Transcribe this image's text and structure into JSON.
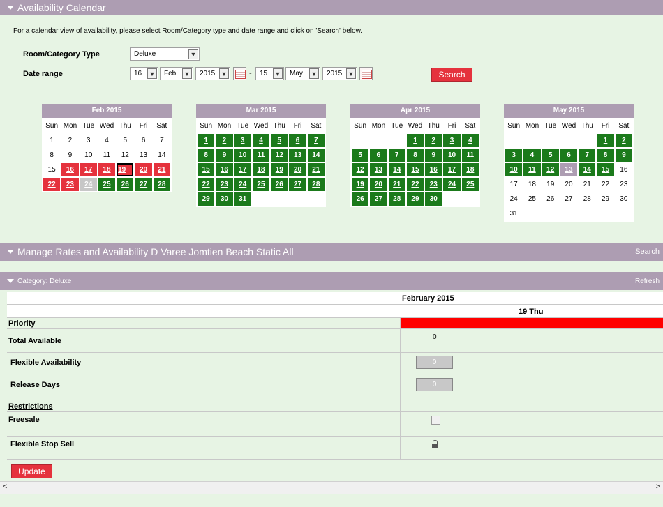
{
  "availability": {
    "title": "Availability Calendar",
    "intro": "For a calendar view of availability, please select Room/Category type and date range and click on 'Search' below.",
    "room_label": "Room/Category Type",
    "room_value": "Deluxe",
    "date_label": "Date range",
    "from_day": "16",
    "from_month": "Feb",
    "from_year": "2015",
    "separator": "-",
    "to_day": "15",
    "to_month": "May",
    "to_year": "2015",
    "search_label": "Search"
  },
  "weekdays": [
    "Sun",
    "Mon",
    "Tue",
    "Wed",
    "Thu",
    "Fri",
    "Sat"
  ],
  "calendars": [
    {
      "title": "Feb 2015",
      "weeks": [
        [
          [
            "1",
            ""
          ],
          [
            "2",
            ""
          ],
          [
            "3",
            ""
          ],
          [
            "4",
            ""
          ],
          [
            "5",
            ""
          ],
          [
            "6",
            ""
          ],
          [
            "7",
            ""
          ]
        ],
        [
          [
            "8",
            ""
          ],
          [
            "9",
            ""
          ],
          [
            "10",
            ""
          ],
          [
            "11",
            ""
          ],
          [
            "12",
            ""
          ],
          [
            "13",
            ""
          ],
          [
            "14",
            ""
          ]
        ],
        [
          [
            "15",
            ""
          ],
          [
            "16",
            "r"
          ],
          [
            "17",
            "r"
          ],
          [
            "18",
            "r"
          ],
          [
            "19",
            "r sel"
          ],
          [
            "20",
            "r"
          ],
          [
            "21",
            "r"
          ]
        ],
        [
          [
            "22",
            "r"
          ],
          [
            "23",
            "r"
          ],
          [
            "24",
            "g"
          ],
          [
            "25",
            "a"
          ],
          [
            "26",
            "a"
          ],
          [
            "27",
            "a"
          ],
          [
            "28",
            "a"
          ]
        ]
      ]
    },
    {
      "title": "Mar 2015",
      "weeks": [
        [
          [
            "1",
            "a"
          ],
          [
            "2",
            "a"
          ],
          [
            "3",
            "a"
          ],
          [
            "4",
            "a"
          ],
          [
            "5",
            "a"
          ],
          [
            "6",
            "a"
          ],
          [
            "7",
            "a"
          ]
        ],
        [
          [
            "8",
            "a"
          ],
          [
            "9",
            "a"
          ],
          [
            "10",
            "a"
          ],
          [
            "11",
            "a"
          ],
          [
            "12",
            "a"
          ],
          [
            "13",
            "a"
          ],
          [
            "14",
            "a"
          ]
        ],
        [
          [
            "15",
            "a"
          ],
          [
            "16",
            "a"
          ],
          [
            "17",
            "a"
          ],
          [
            "18",
            "a"
          ],
          [
            "19",
            "a"
          ],
          [
            "20",
            "a"
          ],
          [
            "21",
            "a"
          ]
        ],
        [
          [
            "22",
            "a"
          ],
          [
            "23",
            "a"
          ],
          [
            "24",
            "a"
          ],
          [
            "25",
            "a"
          ],
          [
            "26",
            "a"
          ],
          [
            "27",
            "a"
          ],
          [
            "28",
            "a"
          ]
        ],
        [
          [
            "29",
            "a"
          ],
          [
            "30",
            "a"
          ],
          [
            "31",
            "a"
          ],
          [
            "",
            ""
          ],
          [
            "",
            ""
          ],
          [
            "",
            ""
          ],
          [
            "",
            ""
          ]
        ]
      ]
    },
    {
      "title": "Apr 2015",
      "weeks": [
        [
          [
            "",
            ""
          ],
          [
            "",
            ""
          ],
          [
            "",
            ""
          ],
          [
            "1",
            "a"
          ],
          [
            "2",
            "a"
          ],
          [
            "3",
            "a"
          ],
          [
            "4",
            "a"
          ]
        ],
        [
          [
            "5",
            "a"
          ],
          [
            "6",
            "a"
          ],
          [
            "7",
            "a"
          ],
          [
            "8",
            "a"
          ],
          [
            "9",
            "a"
          ],
          [
            "10",
            "a"
          ],
          [
            "11",
            "a"
          ]
        ],
        [
          [
            "12",
            "a"
          ],
          [
            "13",
            "a"
          ],
          [
            "14",
            "a"
          ],
          [
            "15",
            "a"
          ],
          [
            "16",
            "a"
          ],
          [
            "17",
            "a"
          ],
          [
            "18",
            "a"
          ]
        ],
        [
          [
            "19",
            "a"
          ],
          [
            "20",
            "a"
          ],
          [
            "21",
            "a"
          ],
          [
            "22",
            "a"
          ],
          [
            "23",
            "a"
          ],
          [
            "24",
            "a"
          ],
          [
            "25",
            "a"
          ]
        ],
        [
          [
            "26",
            "a"
          ],
          [
            "27",
            "a"
          ],
          [
            "28",
            "a"
          ],
          [
            "29",
            "a"
          ],
          [
            "30",
            "a"
          ],
          [
            "",
            ""
          ],
          [
            "",
            ""
          ]
        ]
      ]
    },
    {
      "title": "May 2015",
      "weeks": [
        [
          [
            "",
            ""
          ],
          [
            "",
            ""
          ],
          [
            "",
            ""
          ],
          [
            "",
            ""
          ],
          [
            "",
            ""
          ],
          [
            "1",
            "a"
          ],
          [
            "2",
            "a"
          ]
        ],
        [
          [
            "3",
            "a"
          ],
          [
            "4",
            "a"
          ],
          [
            "5",
            "a"
          ],
          [
            "6",
            "a"
          ],
          [
            "7",
            "a"
          ],
          [
            "8",
            "a"
          ],
          [
            "9",
            "a"
          ]
        ],
        [
          [
            "10",
            "a"
          ],
          [
            "11",
            "a"
          ],
          [
            "12",
            "a"
          ],
          [
            "13",
            "p"
          ],
          [
            "14",
            "a"
          ],
          [
            "15",
            "a"
          ],
          [
            "16",
            ""
          ]
        ],
        [
          [
            "17",
            ""
          ],
          [
            "18",
            ""
          ],
          [
            "19",
            ""
          ],
          [
            "20",
            ""
          ],
          [
            "21",
            ""
          ],
          [
            "22",
            ""
          ],
          [
            "23",
            ""
          ]
        ],
        [
          [
            "24",
            ""
          ],
          [
            "25",
            ""
          ],
          [
            "26",
            ""
          ],
          [
            "27",
            ""
          ],
          [
            "28",
            ""
          ],
          [
            "29",
            ""
          ],
          [
            "30",
            ""
          ]
        ],
        [
          [
            "31",
            ""
          ],
          [
            "",
            ""
          ],
          [
            "",
            ""
          ],
          [
            "",
            ""
          ],
          [
            "",
            ""
          ],
          [
            "",
            ""
          ],
          [
            "",
            ""
          ]
        ]
      ]
    }
  ],
  "manage": {
    "title": "Manage Rates and Availability D Varee Jomtien Beach Static All",
    "search_link": "Search"
  },
  "category": {
    "title": "Category: Deluxe",
    "refresh_link": "Refresh"
  },
  "grid": {
    "month": "February 2015",
    "day": "19 Thu",
    "priority_label": "Priority",
    "priority_color": "#ff0000",
    "total_label": "Total Available",
    "total_value": "0",
    "flex_label": "Flexible Availability",
    "flex_value": "0",
    "release_label": "Release Days",
    "release_value": "0",
    "restrictions_label": "Restrictions",
    "freesale_label": "Freesale",
    "stopsell_label": "Flexible Stop Sell"
  },
  "update_label": "Update"
}
